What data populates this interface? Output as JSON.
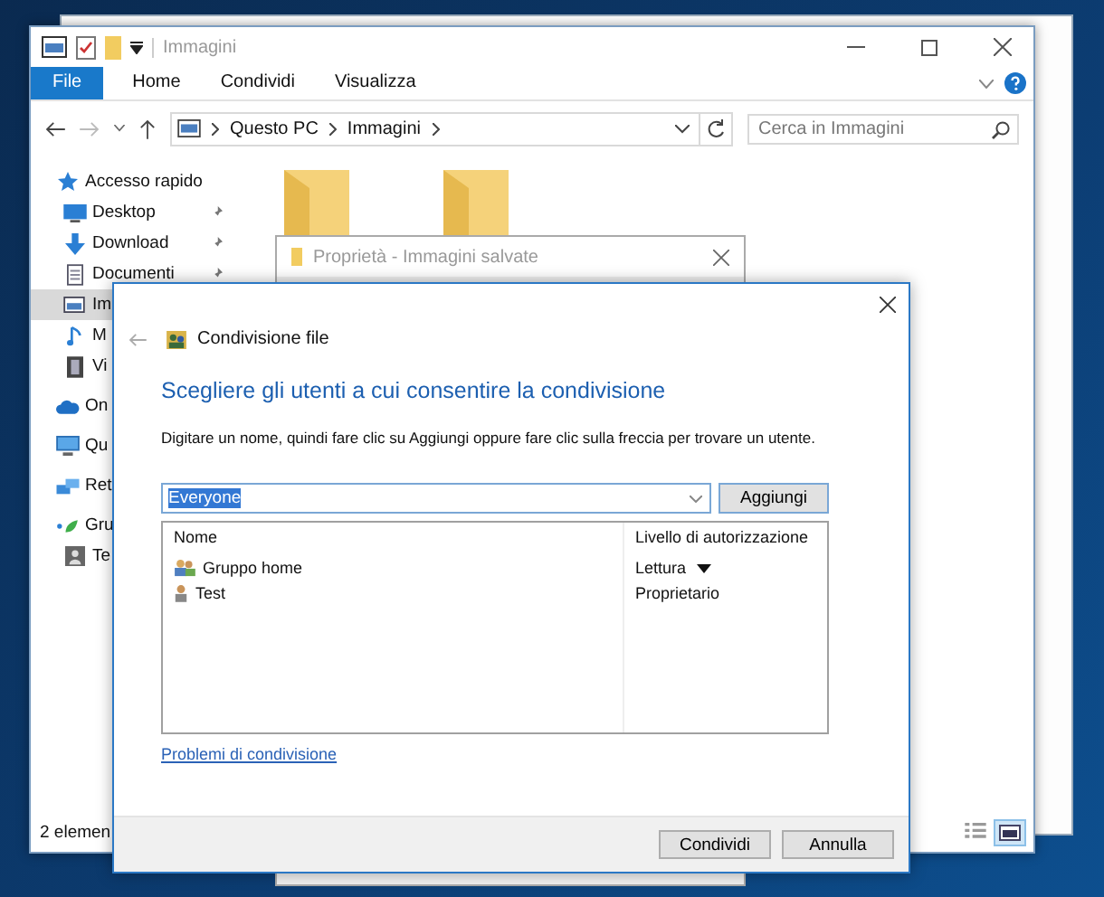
{
  "explorer": {
    "title": "Immagini",
    "ribbon_tabs": [
      {
        "label": "File",
        "kind": "file"
      },
      {
        "label": "Home",
        "kind": "tab"
      },
      {
        "label": "Condividi",
        "kind": "tab"
      },
      {
        "label": "Visualizza",
        "kind": "tab"
      }
    ],
    "breadcrumb": [
      "Questo PC",
      "Immagini"
    ],
    "search": {
      "placeholder": "Cerca in Immagini"
    },
    "sidebar": [
      {
        "label": "Accesso rapido",
        "kind": "star",
        "selected": false,
        "pinned": false,
        "children": [
          {
            "label": "Desktop",
            "kind": "desktop",
            "selected": false,
            "pinned": true
          },
          {
            "label": "Download",
            "kind": "download",
            "selected": false,
            "pinned": true
          },
          {
            "label": "Documenti",
            "kind": "document",
            "selected": false,
            "pinned": true
          },
          {
            "label": "Im",
            "kind": "image",
            "selected": true
          },
          {
            "label": "M",
            "kind": "music",
            "selected": false
          },
          {
            "label": "Vi",
            "kind": "video",
            "selected": false
          }
        ]
      },
      {
        "label": "On",
        "kind": "cloud",
        "selected": false
      },
      {
        "label": "Qu",
        "kind": "pc",
        "selected": false
      },
      {
        "label": "Ret",
        "kind": "network",
        "selected": false
      },
      {
        "label": "Gru",
        "kind": "homegroup",
        "selected": false,
        "children": [
          {
            "label": "Te",
            "kind": "user",
            "selected": false
          }
        ]
      }
    ],
    "status": "2 elemen"
  },
  "properties": {
    "title": "Proprietà - Immagini salvate"
  },
  "dialog": {
    "title": "Condivisione file",
    "heading": "Scegliere gli utenti a cui consentire la condivisione",
    "instruction": "Digitare un nome, quindi fare clic su Aggiungi oppure fare clic sulla freccia per trovare un utente.",
    "name_field": {
      "value": "Everyone"
    },
    "add_button": "Aggiungi",
    "columns": [
      "Nome",
      "Livello di autorizzazione"
    ],
    "rows": [
      {
        "name": "Gruppo home",
        "kind": "group",
        "permission": "Lettura",
        "dropdown": true
      },
      {
        "name": "Test",
        "kind": "user",
        "permission": "Proprietario",
        "dropdown": false
      }
    ],
    "link": "Problemi di condivisione",
    "buttons": [
      "Condividi",
      "Annulla"
    ]
  }
}
